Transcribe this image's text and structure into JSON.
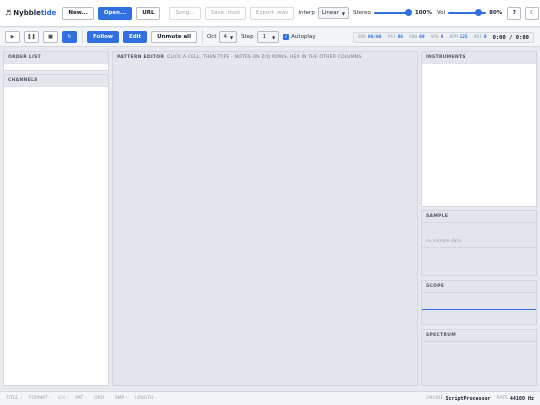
{
  "app": {
    "name_prefix": "Nybble",
    "name_suffix": "tide"
  },
  "toolbar": {
    "new_label": "New...",
    "open_label": "Open...",
    "url_label": "URL",
    "song_label": "Song...",
    "save_mod_label": "Save .mod",
    "export_wav_label": "Export .wav",
    "interp_label": "Interp",
    "interp_value": "Linear",
    "stereo_label": "Stereo",
    "stereo_pct": "100%",
    "stereo_level": 1.0,
    "vol_label": "Vol",
    "vol_pct": "80%",
    "vol_level": 0.8,
    "help_label": "?",
    "theme_label": "☾"
  },
  "transport": {
    "follow_label": "Follow",
    "edit_label": "Edit",
    "unmute_label": "Unmute all",
    "oct_label": "Oct",
    "oct_value": "4",
    "step_label": "Step",
    "step_value": "1",
    "autoplay_label": "Autoplay"
  },
  "status": {
    "ord_k": "ORD",
    "ord_v": "00/00",
    "pat_k": "PAT",
    "pat_v": "00",
    "row_k": "ROW",
    "row_v": "00",
    "spd_k": "SPD",
    "spd_v": "6",
    "bpm_k": "BPM",
    "bpm_v": "125",
    "voi_k": "VOI",
    "voi_v": "0",
    "time": "0:00 / 0:00"
  },
  "panels": {
    "order_list": "ORDER LIST",
    "channels": "CHANNELS",
    "pattern_editor": "PATTERN EDITOR",
    "pattern_hint": "CLICK A CELL, THEN TYPE - NOTES ON Z/Q ROWS, HEX IN THE OTHER COLUMNS",
    "instruments": "INSTRUMENTS",
    "sample": "SAMPLE",
    "sample_empty": "no sample data",
    "scope": "SCOPE",
    "spectrum": "SPECTRUM"
  },
  "footer": {
    "meta": [
      "TITLE –",
      "FORMAT –",
      "CH –",
      "PAT –",
      "ORD –",
      "SMP –",
      "LENGTH –"
    ],
    "engine_label": "ENGINE",
    "engine_value": "ScriptProcessor",
    "rate_label": "RATE",
    "rate_value": "44100 Hz"
  },
  "colors": {
    "accent": "#2f6fe0"
  }
}
